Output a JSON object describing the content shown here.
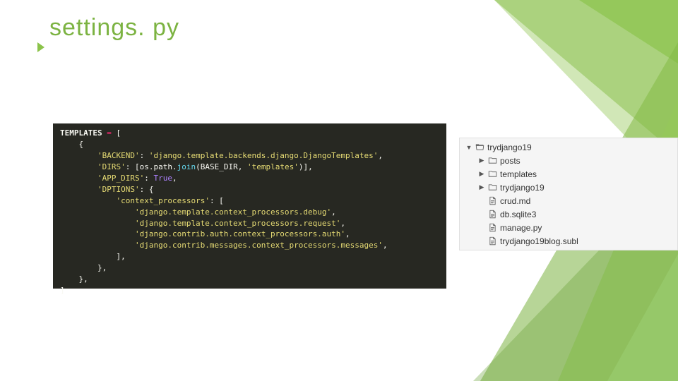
{
  "title": "settings. py",
  "code": {
    "var_name": "TEMPLATES",
    "eq": " = ",
    "bracket_open": "[",
    "brace_open": "    {",
    "backend_key": "'BACKEND'",
    "backend_val": "'django.template.backends.django.DjangoTemplates'",
    "dirs_key": "'DIRS'",
    "dirs_open": ": [",
    "dirs_os": "os",
    "dirs_dot1": ".",
    "dirs_path": "path",
    "dirs_dot2": ".",
    "dirs_join": "join",
    "dirs_paren_open": "(",
    "dirs_basedir": "BASE_DIR",
    "dirs_comma": ", ",
    "dirs_tpl": "'templates'",
    "dirs_paren_close": ")",
    "dirs_close": "],",
    "appdirs_key": "'APP_DIRS'",
    "appdirs_val": "True",
    "options_key": "'DPTIONS'",
    "options_open": ": {",
    "cp_key": "'context_processors'",
    "cp_open": ": [",
    "cp1": "'django.template.context_processors.debug'",
    "cp2": "'django.template.context_processors.request'",
    "cp3": "'django.contrib.auth.context_processors.auth'",
    "cp4": "'django.contrib.messages.context_processors.messages'",
    "cp_close": "            ],",
    "options_close": "        },",
    "brace_close": "    },",
    "bracket_close": "]",
    "colon": ": ",
    "comma": ","
  },
  "tree": [
    {
      "label": "trydjango19",
      "icon": "folder-open",
      "arrow": "down",
      "indent": 0
    },
    {
      "label": "posts",
      "icon": "folder-closed",
      "arrow": "right",
      "indent": 1
    },
    {
      "label": "templates",
      "icon": "folder-closed",
      "arrow": "right",
      "indent": 1
    },
    {
      "label": "trydjango19",
      "icon": "folder-closed",
      "arrow": "right",
      "indent": 1
    },
    {
      "label": "crud.md",
      "icon": "file",
      "arrow": "none",
      "indent": 1
    },
    {
      "label": "db.sqlite3",
      "icon": "file",
      "arrow": "none",
      "indent": 1
    },
    {
      "label": "manage.py",
      "icon": "file",
      "arrow": "none",
      "indent": 1
    },
    {
      "label": "trydjango19blog.subl",
      "icon": "file",
      "arrow": "none",
      "indent": 1
    }
  ]
}
